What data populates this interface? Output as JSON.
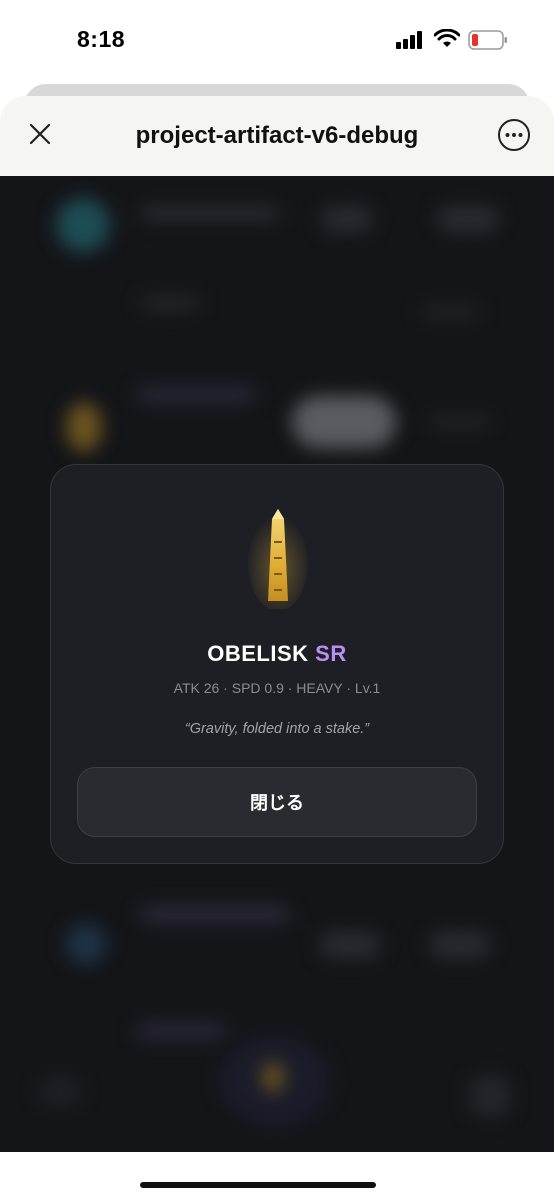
{
  "status_bar": {
    "time": "8:18"
  },
  "header": {
    "title": "project-artifact-v6-debug"
  },
  "modal": {
    "name": "OBELISK",
    "rarity": "SR",
    "stats": "ATK 26 · SPD 0.9 · HEAVY · Lv.1",
    "quote": "“Gravity, folded into a stake.”",
    "close_label": "閉じる"
  },
  "colors": {
    "rarity_accent": "#b98ef5",
    "artifact_gold": "#e8b93a",
    "background": "#141519"
  },
  "icons": {
    "close": "close-icon",
    "more": "more-icon",
    "artifact": "obelisk-icon"
  }
}
